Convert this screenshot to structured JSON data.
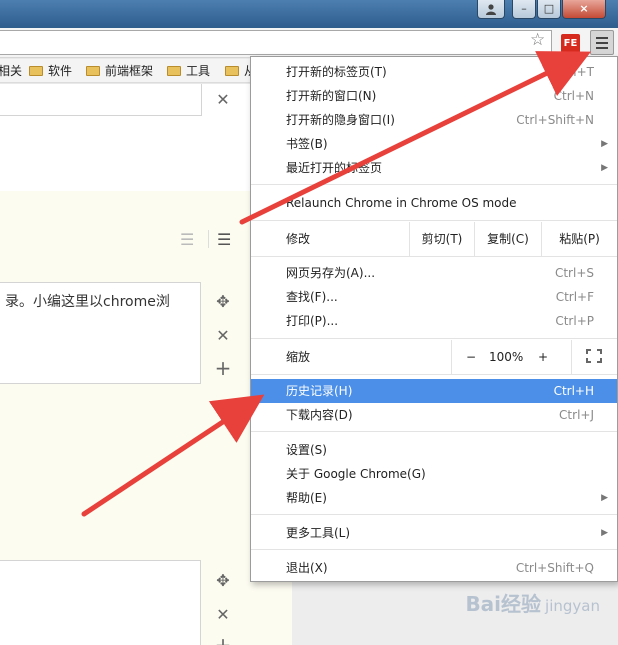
{
  "window": {
    "close_label": "×",
    "min_label": "–",
    "max_label": "□"
  },
  "toolbar": {
    "star_icon": "star-icon",
    "extension_label": "FE",
    "menu_icon": "hamburger-menu-icon"
  },
  "bookmarks": [
    {
      "label": "相关",
      "has_folder": false
    },
    {
      "label": "软件",
      "has_folder": true
    },
    {
      "label": "前端框架",
      "has_folder": true
    },
    {
      "label": "工具",
      "has_folder": true
    },
    {
      "label": "从",
      "has_folder": true
    }
  ],
  "page": {
    "box_text": "录。小编这里以chrome浏",
    "watermark": "Bai经验",
    "watermark_sub": "jingyan"
  },
  "menu": {
    "items": [
      {
        "label": "打开新的标签页(T)",
        "shortcut": "Ctrl+T"
      },
      {
        "label": "打开新的窗口(N)",
        "shortcut": "Ctrl+N"
      },
      {
        "label": "打开新的隐身窗口(I)",
        "shortcut": "Ctrl+Shift+N"
      },
      {
        "label": "书签(B)",
        "shortcut": ""
      },
      {
        "label": "最近打开的标签页",
        "shortcut": ""
      },
      {
        "label": "Relaunch Chrome in Chrome OS mode",
        "shortcut": ""
      },
      {
        "label": "网页另存为(A)...",
        "shortcut": "Ctrl+S"
      },
      {
        "label": "查找(F)...",
        "shortcut": "Ctrl+F"
      },
      {
        "label": "打印(P)...",
        "shortcut": "Ctrl+P"
      },
      {
        "label": "历史记录(H)",
        "shortcut": "Ctrl+H"
      },
      {
        "label": "下载内容(D)",
        "shortcut": "Ctrl+J"
      },
      {
        "label": "设置(S)",
        "shortcut": ""
      },
      {
        "label": "关于 Google Chrome(G)",
        "shortcut": ""
      },
      {
        "label": "帮助(E)",
        "shortcut": ""
      },
      {
        "label": "更多工具(L)",
        "shortcut": ""
      },
      {
        "label": "退出(X)",
        "shortcut": "Ctrl+Shift+Q"
      }
    ],
    "edit": {
      "label": "修改",
      "cut": "剪切(T)",
      "copy": "复制(C)",
      "paste": "粘贴(P)"
    },
    "zoom": {
      "label": "缩放",
      "minus": "−",
      "value": "100%",
      "plus": "+"
    },
    "highlight_color": "#4b8fe8"
  },
  "annotation_color": "#e8403a"
}
